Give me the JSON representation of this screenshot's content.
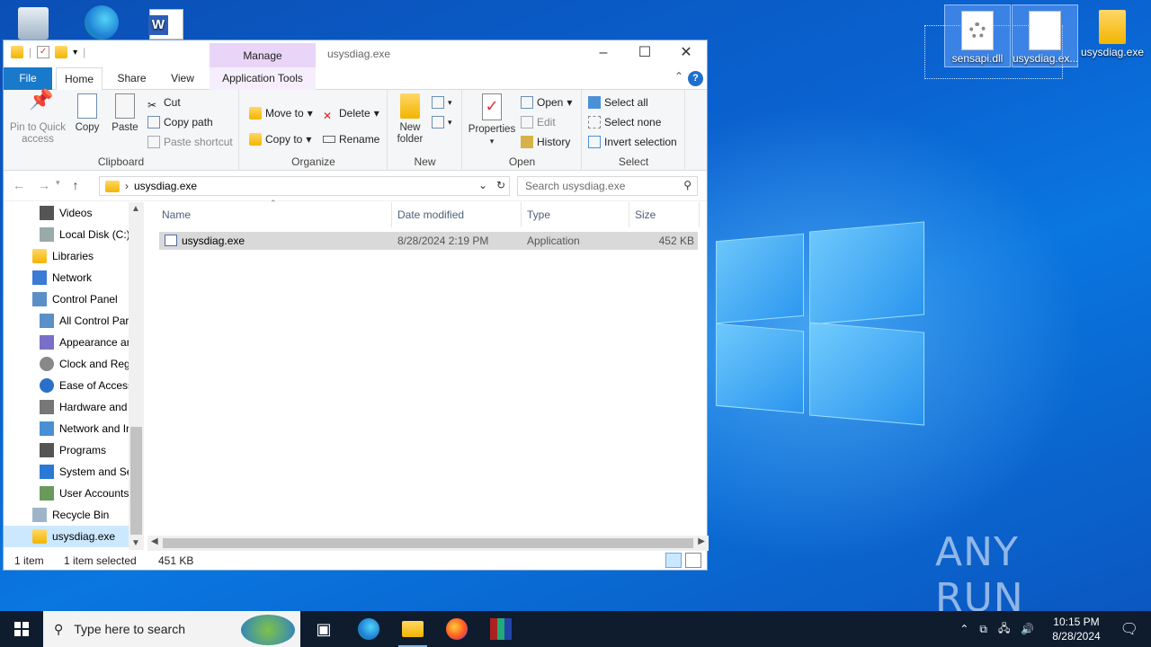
{
  "desktop": {
    "icons": [
      {
        "label": "sensapi.dll"
      },
      {
        "label": "usysdiag.ex..."
      },
      {
        "label": "usysdiag.exe"
      }
    ],
    "watermark": "ANY RUN"
  },
  "explorer": {
    "title": "usysdiag.exe",
    "context_tab": "Manage",
    "tabs": {
      "file": "File",
      "home": "Home",
      "share": "Share",
      "view": "View",
      "app_tools": "Application Tools"
    },
    "ribbon": {
      "clipboard": {
        "label": "Clipboard",
        "pin": "Pin to Quick access",
        "copy": "Copy",
        "paste": "Paste",
        "cut": "Cut",
        "copy_path": "Copy path",
        "paste_shortcut": "Paste shortcut"
      },
      "organize": {
        "label": "Organize",
        "move_to": "Move to",
        "copy_to": "Copy to",
        "delete": "Delete",
        "rename": "Rename"
      },
      "new": {
        "label": "New",
        "new_folder": "New folder"
      },
      "open": {
        "label": "Open",
        "properties": "Properties",
        "open": "Open",
        "edit": "Edit",
        "history": "History"
      },
      "select": {
        "label": "Select",
        "select_all": "Select all",
        "select_none": "Select none",
        "invert": "Invert selection"
      }
    },
    "address": {
      "path": "usysdiag.exe",
      "search_placeholder": "Search usysdiag.exe"
    },
    "nav_items": [
      {
        "label": "Videos"
      },
      {
        "label": "Local Disk (C:)"
      },
      {
        "label": "Libraries"
      },
      {
        "label": "Network"
      },
      {
        "label": "Control Panel"
      },
      {
        "label": "All Control Par"
      },
      {
        "label": "Appearance an"
      },
      {
        "label": "Clock and Regi"
      },
      {
        "label": "Ease of Access"
      },
      {
        "label": "Hardware and"
      },
      {
        "label": "Network and Ir"
      },
      {
        "label": "Programs"
      },
      {
        "label": "System and Se"
      },
      {
        "label": "User Accounts"
      },
      {
        "label": "Recycle Bin"
      },
      {
        "label": "usysdiag.exe"
      }
    ],
    "columns": {
      "name": "Name",
      "date": "Date modified",
      "type": "Type",
      "size": "Size"
    },
    "files": [
      {
        "name": "usysdiag.exe",
        "date": "8/28/2024 2:19 PM",
        "type": "Application",
        "size": "452 KB"
      }
    ],
    "status": {
      "count": "1 item",
      "selected": "1 item selected",
      "size": "451 KB"
    }
  },
  "taskbar": {
    "search_placeholder": "Type here to search",
    "time": "10:15 PM",
    "date": "8/28/2024"
  }
}
